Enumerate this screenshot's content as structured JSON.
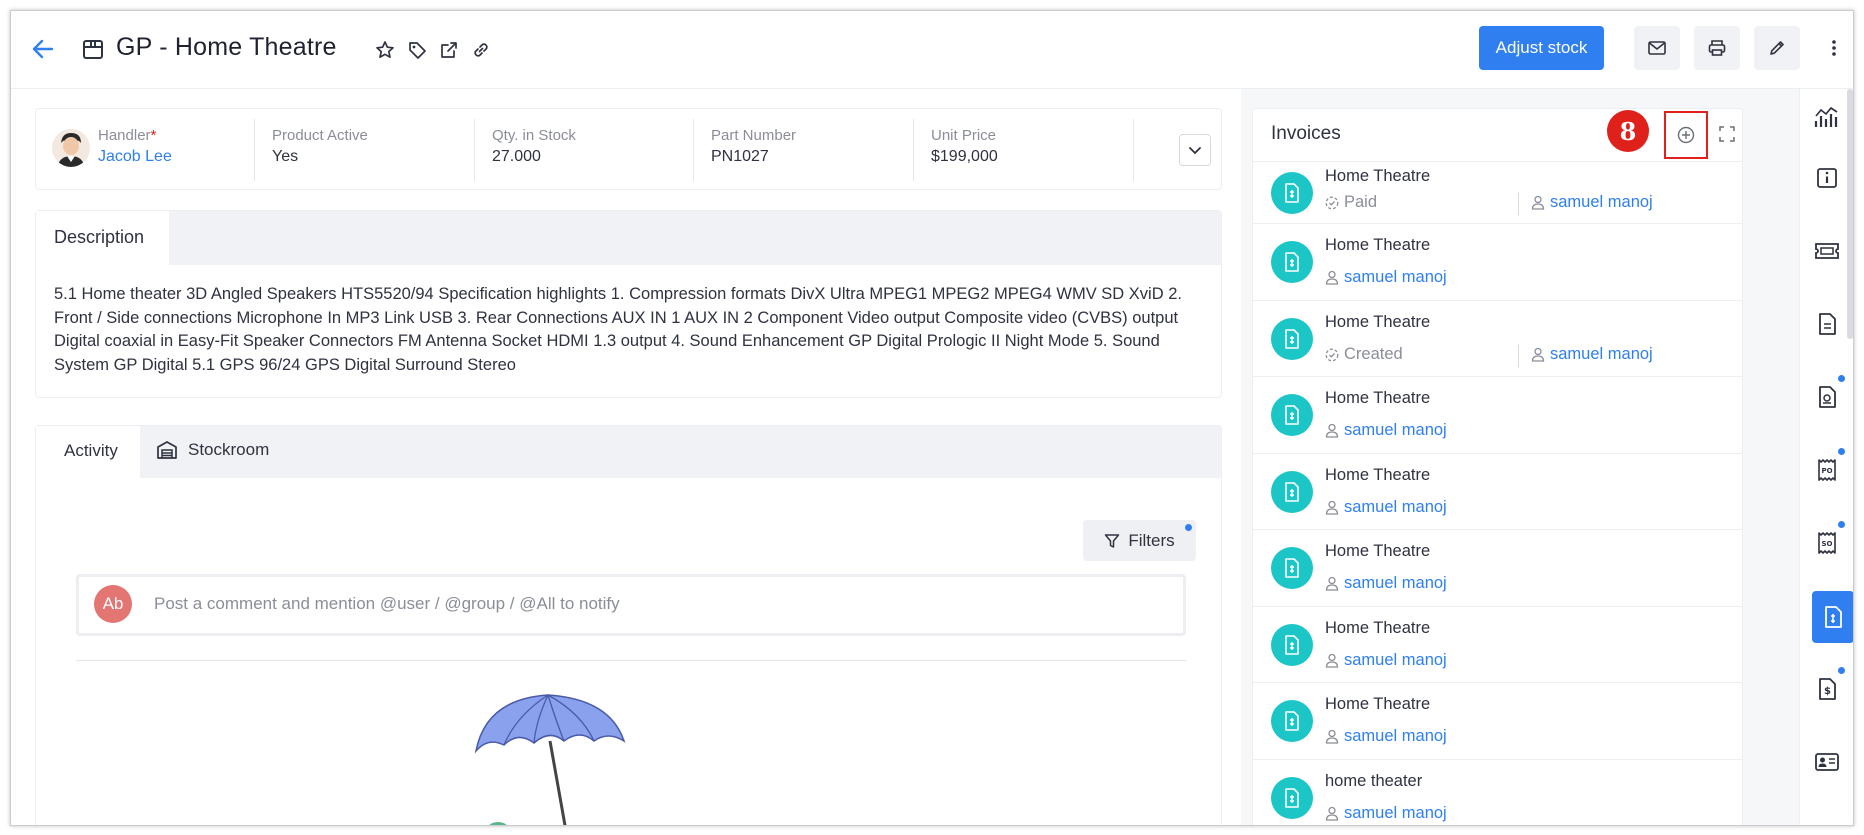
{
  "header": {
    "title": "GP - Home Theatre",
    "adjust_stock_label": "Adjust stock"
  },
  "summary": {
    "handler_label": "Handler",
    "handler_required_mark": "*",
    "handler_value": "Jacob Lee",
    "product_active_label": "Product Active",
    "product_active_value": "Yes",
    "qty_label": "Qty. in Stock",
    "qty_value": "27.000",
    "part_number_label": "Part Number",
    "part_number_value": "PN1027",
    "unit_price_label": "Unit Price",
    "unit_price_value": "$199,000"
  },
  "description": {
    "tab_label": "Description",
    "text": "5.1 Home theater 3D Angled Speakers HTS5520/94 Specification highlights 1. Compression formats DivX Ultra MPEG1 MPEG2 MPEG4 WMV SD XviD 2. Front / Side connections Microphone In MP3 Link USB 3. Rear Connections AUX IN 1 AUX IN 2 Component Video output Composite video (CVBS) output Digital coaxial in Easy-Fit Speaker Connectors FM Antenna Socket HDMI 1.3 output 4. Sound Enhancement GP Digital Prologic II Night Mode 5. Sound System GP Digital 5.1 GPS 96/24 GPS Digital Surround Stereo"
  },
  "activity": {
    "tabs": [
      "Activity",
      "Stockroom"
    ],
    "filters_label": "Filters",
    "comment_avatar_initials": "Ab",
    "comment_placeholder": "Post a comment and mention @user / @group / @All to notify"
  },
  "invoices": {
    "title": "Invoices",
    "step_badge": "8",
    "items": [
      {
        "name": "Home Theatre",
        "status": "Paid",
        "user": "samuel manoj"
      },
      {
        "name": "Home Theatre",
        "status": "",
        "user": "samuel manoj"
      },
      {
        "name": "Home Theatre",
        "status": "Created",
        "user": "samuel manoj"
      },
      {
        "name": "Home Theatre",
        "status": "",
        "user": "samuel manoj"
      },
      {
        "name": "Home Theatre",
        "status": "",
        "user": "samuel manoj"
      },
      {
        "name": "Home Theatre",
        "status": "",
        "user": "samuel manoj"
      },
      {
        "name": "Home Theatre",
        "status": "",
        "user": "samuel manoj"
      },
      {
        "name": "Home Theatre",
        "status": "",
        "user": "samuel manoj"
      },
      {
        "name": "home theater",
        "status": "",
        "user": "samuel manoj"
      }
    ]
  },
  "colors": {
    "accent": "#2f7ff0",
    "invoice_icon": "#1dc6c6",
    "highlight": "#e0211b",
    "comment_avatar": "#e37573"
  },
  "rail": {
    "icons": [
      "analytics-icon",
      "info-icon",
      "ticket-icon",
      "document-icon",
      "quote-icon",
      "purchase-order-icon",
      "sales-order-icon",
      "invoice-icon",
      "payment-icon",
      "contact-card-icon"
    ]
  }
}
